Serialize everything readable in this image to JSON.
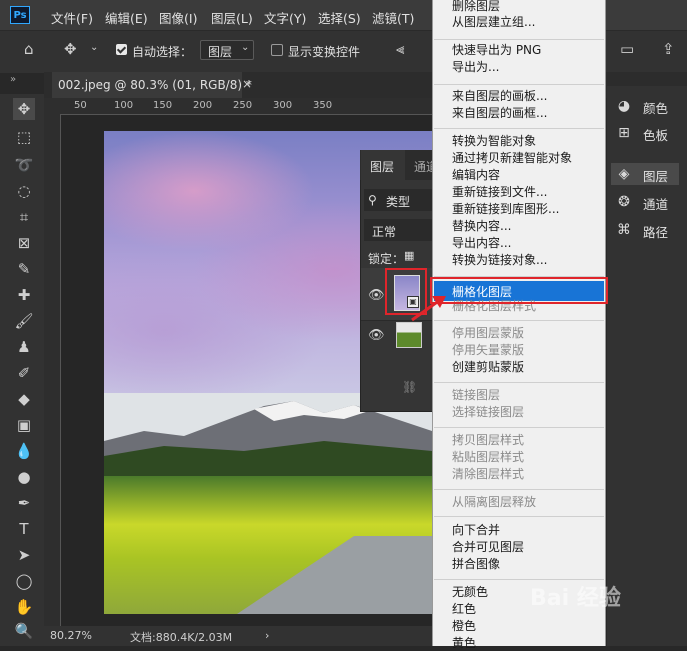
{
  "menubar": {
    "logo": "Ps",
    "items": [
      "文件(F)",
      "编辑(E)",
      "图像(I)",
      "图层(L)",
      "文字(Y)",
      "选择(S)",
      "滤镜(T)"
    ]
  },
  "options": {
    "auto_select_label": "自动选择：",
    "auto_select_target": "图层",
    "show_transform_label": "显示变换控件"
  },
  "document": {
    "tab_title": "002.jpeg @ 80.3% (01, RGB/8) *",
    "close_glyph": "×",
    "ruler_marks": [
      "50",
      "100",
      "150",
      "200",
      "250",
      "300",
      "350"
    ],
    "zoom": "80.27%",
    "doc_size": "文档:880.4K/2.03M"
  },
  "dock": {
    "items": [
      {
        "label": "颜色",
        "icon": "palette-icon"
      },
      {
        "label": "色板",
        "icon": "grid-icon"
      },
      {
        "label": "图层",
        "icon": "layers-icon"
      },
      {
        "label": "通道",
        "icon": "channels-icon"
      },
      {
        "label": "路径",
        "icon": "paths-icon"
      }
    ]
  },
  "layers_panel": {
    "tab_layers": "图层",
    "tab_channels": "通道",
    "search_kind": "类型",
    "blend_mode": "正常",
    "lock_label": "锁定："
  },
  "context_menu": {
    "groups": [
      [
        {
          "label": "删除图层",
          "enabled": true
        },
        {
          "label": "从图层建立组...",
          "enabled": true
        }
      ],
      [
        {
          "label": "快速导出为 PNG",
          "enabled": true
        },
        {
          "label": "导出为...",
          "enabled": true
        }
      ],
      [
        {
          "label": "来自图层的画板...",
          "enabled": true
        },
        {
          "label": "来自图层的画框...",
          "enabled": true
        }
      ],
      [
        {
          "label": "转换为智能对象",
          "enabled": true
        },
        {
          "label": "通过拷贝新建智能对象",
          "enabled": true
        },
        {
          "label": "编辑内容",
          "enabled": true
        },
        {
          "label": "重新链接到文件...",
          "enabled": true
        },
        {
          "label": "重新链接到库图形...",
          "enabled": true
        },
        {
          "label": "替换内容...",
          "enabled": true
        },
        {
          "label": "导出内容...",
          "enabled": true
        },
        {
          "label": "转换为链接对象...",
          "enabled": true
        }
      ],
      [
        {
          "label": "栅格化图层",
          "enabled": true,
          "highlighted": true
        },
        {
          "label": "栅格化图层样式",
          "enabled": false
        }
      ],
      [
        {
          "label": "停用图层蒙版",
          "enabled": false
        },
        {
          "label": "停用矢量蒙版",
          "enabled": false
        },
        {
          "label": "创建剪贴蒙版",
          "enabled": true
        }
      ],
      [
        {
          "label": "链接图层",
          "enabled": false
        },
        {
          "label": "选择链接图层",
          "enabled": false
        }
      ],
      [
        {
          "label": "拷贝图层样式",
          "enabled": false
        },
        {
          "label": "粘贴图层样式",
          "enabled": false
        },
        {
          "label": "清除图层样式",
          "enabled": false
        }
      ],
      [
        {
          "label": "从隔离图层释放",
          "enabled": false
        }
      ],
      [
        {
          "label": "向下合并",
          "enabled": true
        },
        {
          "label": "合并可见图层",
          "enabled": true
        },
        {
          "label": "拼合图像",
          "enabled": true
        }
      ],
      [
        {
          "label": "无颜色",
          "enabled": true
        },
        {
          "label": "红色",
          "enabled": true
        },
        {
          "label": "橙色",
          "enabled": true
        },
        {
          "label": "黄色",
          "enabled": true
        }
      ]
    ]
  },
  "watermark": "Bai 经验",
  "colors": {
    "highlight": "#1874d6",
    "annotation_red": "#e0252b",
    "ps_blue": "#31a8ff"
  }
}
